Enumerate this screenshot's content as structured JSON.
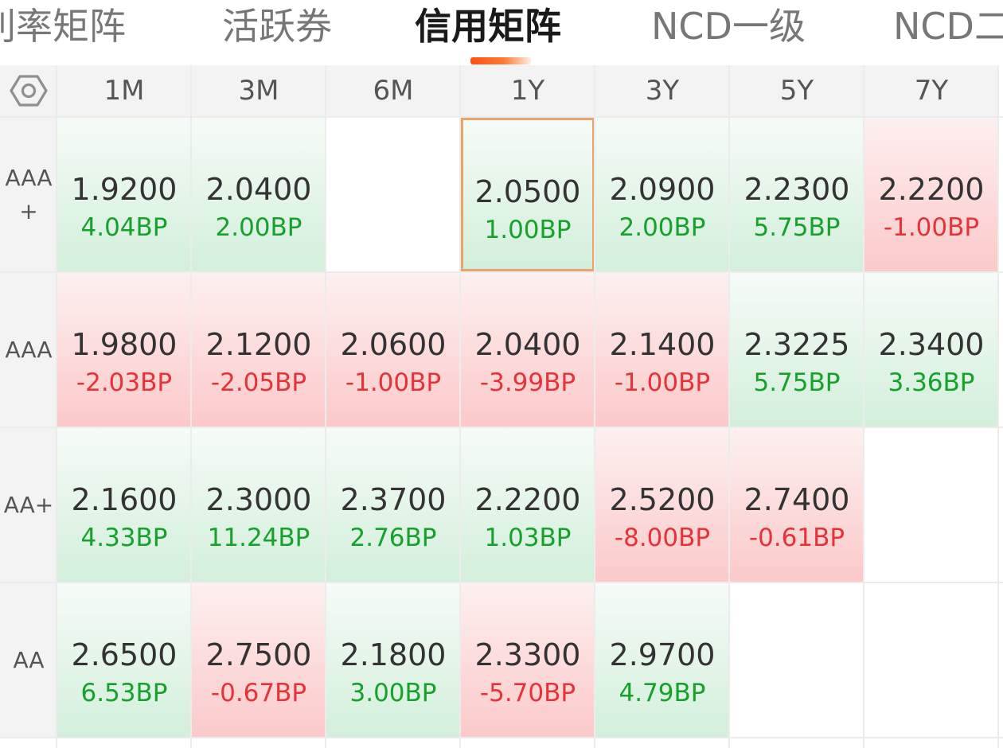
{
  "tabs": [
    {
      "label": "利率矩阵",
      "active": false
    },
    {
      "label": "活跃券",
      "active": false
    },
    {
      "label": "信用矩阵",
      "active": true
    },
    {
      "label": "NCD一级",
      "active": false
    },
    {
      "label": "NCD二级",
      "active": false
    }
  ],
  "matrix": {
    "settings_icon": "hexagon-gear-icon",
    "columns": [
      "1M",
      "3M",
      "6M",
      "1Y",
      "3Y",
      "5Y",
      "7Y"
    ],
    "selected_cell": {
      "row": "AAA+",
      "column": "1Y"
    },
    "rows": [
      {
        "label": "AAA+",
        "cells": [
          {
            "value": "1.9200",
            "change": "4.04BP",
            "trend": "up"
          },
          {
            "value": "2.0400",
            "change": "2.00BP",
            "trend": "up"
          },
          null,
          {
            "value": "2.0500",
            "change": "1.00BP",
            "trend": "up"
          },
          {
            "value": "2.0900",
            "change": "2.00BP",
            "trend": "up"
          },
          {
            "value": "2.2300",
            "change": "5.75BP",
            "trend": "up"
          },
          {
            "value": "2.2200",
            "change": "-1.00BP",
            "trend": "down"
          }
        ]
      },
      {
        "label": "AAA",
        "cells": [
          {
            "value": "1.9800",
            "change": "-2.03BP",
            "trend": "down"
          },
          {
            "value": "2.1200",
            "change": "-2.05BP",
            "trend": "down"
          },
          {
            "value": "2.0600",
            "change": "-1.00BP",
            "trend": "down"
          },
          {
            "value": "2.0400",
            "change": "-3.99BP",
            "trend": "down"
          },
          {
            "value": "2.1400",
            "change": "-1.00BP",
            "trend": "down"
          },
          {
            "value": "2.3225",
            "change": "5.75BP",
            "trend": "up"
          },
          {
            "value": "2.3400",
            "change": "3.36BP",
            "trend": "up"
          }
        ]
      },
      {
        "label": "AA+",
        "cells": [
          {
            "value": "2.1600",
            "change": "4.33BP",
            "trend": "up"
          },
          {
            "value": "2.3000",
            "change": "11.24BP",
            "trend": "up"
          },
          {
            "value": "2.3700",
            "change": "2.76BP",
            "trend": "up"
          },
          {
            "value": "2.2200",
            "change": "1.03BP",
            "trend": "up"
          },
          {
            "value": "2.5200",
            "change": "-8.00BP",
            "trend": "down"
          },
          {
            "value": "2.7400",
            "change": "-0.61BP",
            "trend": "down"
          },
          null
        ]
      },
      {
        "label": "AA",
        "cells": [
          {
            "value": "2.6500",
            "change": "6.53BP",
            "trend": "up"
          },
          {
            "value": "2.7500",
            "change": "-0.67BP",
            "trend": "down"
          },
          {
            "value": "2.1800",
            "change": "3.00BP",
            "trend": "up"
          },
          {
            "value": "2.3300",
            "change": "-5.70BP",
            "trend": "down"
          },
          {
            "value": "2.9700",
            "change": "4.79BP",
            "trend": "up"
          },
          null,
          null
        ]
      }
    ]
  }
}
